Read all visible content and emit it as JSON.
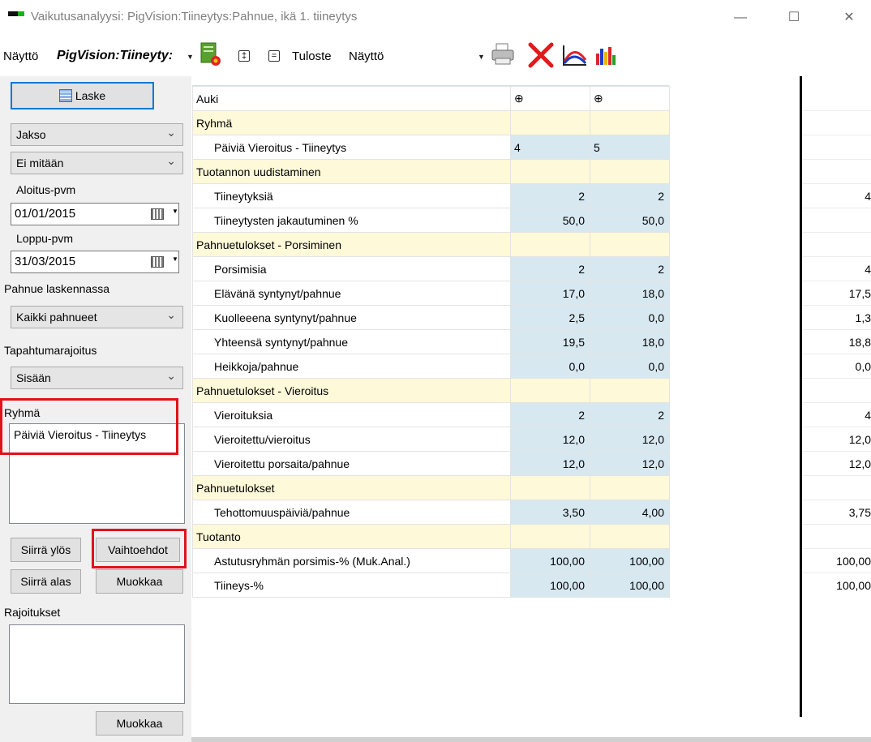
{
  "window": {
    "title": "Vaikutusanalyysi: PigVision:Tiineytys:Pahnue, ikä 1. tiineytys",
    "minimize": "—",
    "maximize": "☐",
    "close": "✕"
  },
  "toolbar": {
    "view_label": "Näyttö",
    "view_value": "PigVision:Tiineyty:",
    "expand_symbol": "‡",
    "collapse_symbol": "=",
    "output_label": "Tuloste",
    "output_value": "Näyttö"
  },
  "left": {
    "calc_button": "Laske",
    "period_combo": "Jakso",
    "none_combo": "Ei mitään",
    "start_label": "Aloitus-pvm",
    "start_date": "01/01/2015",
    "end_label": "Loppu-pvm",
    "end_date": "31/03/2015",
    "litters_label": "Pahnue laskennassa",
    "litters_combo": "Kaikki pahnueet",
    "event_label": "Tapahtumarajoitus",
    "event_combo": "Sisään",
    "group_label": "Ryhmä",
    "group_items": [
      "Päiviä Vieroitus - Tiineytys"
    ],
    "move_up": "Siirrä ylös",
    "options": "Vaihtoehdot",
    "move_down": "Siirrä alas",
    "edit": "Muokkaa",
    "restrictions_label": "Rajoitukset",
    "edit2": "Muokkaa"
  },
  "grid": {
    "header": {
      "label": "Auki",
      "c1": "⊕",
      "c2": "⊕"
    },
    "rows": [
      {
        "type": "sec",
        "label": "Ryhmä"
      },
      {
        "type": "group",
        "label": "Päiviä Vieroitus - Tiineytys",
        "c1": "4",
        "c2": "5",
        "r": ""
      },
      {
        "type": "sec",
        "label": "Tuotannon uudistaminen"
      },
      {
        "type": "data",
        "label": "Tiineytyksiä",
        "c1": "2",
        "c2": "2",
        "r": "4"
      },
      {
        "type": "data",
        "label": "Tiineytysten jakautuminen %",
        "c1": "50,0",
        "c2": "50,0",
        "r": ""
      },
      {
        "type": "sec",
        "label": "Pahnuetulokset - Porsiminen"
      },
      {
        "type": "data",
        "label": "Porsimisia",
        "c1": "2",
        "c2": "2",
        "r": "4"
      },
      {
        "type": "data",
        "label": "Elävänä syntynyt/pahnue",
        "c1": "17,0",
        "c2": "18,0",
        "r": "17,5"
      },
      {
        "type": "data",
        "label": "Kuolleeena syntynyt/pahnue",
        "c1": "2,5",
        "c2": "0,0",
        "r": "1,3"
      },
      {
        "type": "data",
        "label": "Yhteensä syntynyt/pahnue",
        "c1": "19,5",
        "c2": "18,0",
        "r": "18,8"
      },
      {
        "type": "data",
        "label": "Heikkoja/pahnue",
        "c1": "0,0",
        "c2": "0,0",
        "r": "0,0"
      },
      {
        "type": "sec",
        "label": "Pahnuetulokset - Vieroitus"
      },
      {
        "type": "data",
        "label": "Vieroituksia",
        "c1": "2",
        "c2": "2",
        "r": "4"
      },
      {
        "type": "data",
        "label": "Vieroitettu/vieroitus",
        "c1": "12,0",
        "c2": "12,0",
        "r": "12,0"
      },
      {
        "type": "data",
        "label": "Vieroitettu porsaita/pahnue",
        "c1": "12,0",
        "c2": "12,0",
        "r": "12,0"
      },
      {
        "type": "sec",
        "label": "Pahnuetulokset"
      },
      {
        "type": "data",
        "label": "Tehottomuuspäiviä/pahnue",
        "c1": "3,50",
        "c2": "4,00",
        "r": "3,75"
      },
      {
        "type": "sec",
        "label": "Tuotanto"
      },
      {
        "type": "data",
        "label": "Astutusryhmän porsimis-% (Muk.Anal.)",
        "c1": "100,00",
        "c2": "100,00",
        "r": "100,00"
      },
      {
        "type": "data",
        "label": "Tiineys-%",
        "c1": "100,00",
        "c2": "100,00",
        "r": "100,00"
      }
    ]
  },
  "colors": {
    "section_bg": "#fdf9d9",
    "value_bg": "#d7e8f1",
    "highlight": "#e0121b",
    "focus": "#0078d7"
  }
}
